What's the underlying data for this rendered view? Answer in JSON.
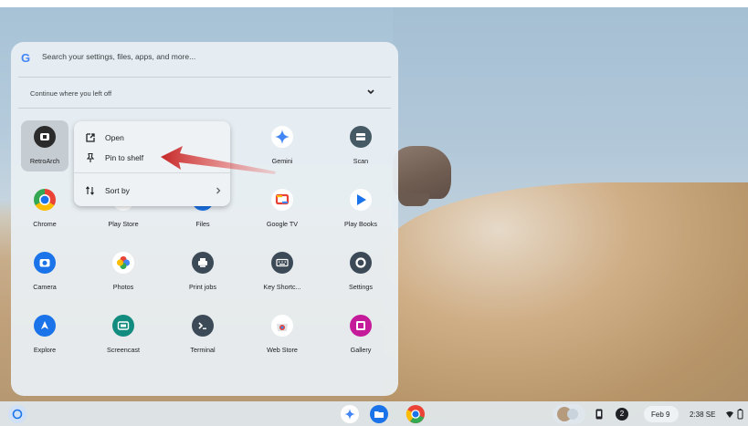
{
  "search": {
    "placeholder": "Search your settings, files, apps, and more..."
  },
  "continue": {
    "label": "Continue where you left off"
  },
  "apps": [
    {
      "label": "RetroArch",
      "icon": "retroarch-icon",
      "color": "#2b2b2b"
    },
    {
      "label": "",
      "icon": "",
      "color": ""
    },
    {
      "label": "",
      "icon": "",
      "color": ""
    },
    {
      "label": "Gemini",
      "icon": "gemini-icon",
      "color": "#4285f4"
    },
    {
      "label": "Scan",
      "icon": "scan-icon",
      "color": "#455a64"
    },
    {
      "label": "Chrome",
      "icon": "chrome-icon",
      "color": "#ea4335"
    },
    {
      "label": "Play Store",
      "icon": "play-store-icon",
      "color": "#34a853"
    },
    {
      "label": "Files",
      "icon": "files-icon",
      "color": "#1a73e8"
    },
    {
      "label": "Google TV",
      "icon": "google-tv-icon",
      "color": "#ea4335"
    },
    {
      "label": "Play Books",
      "icon": "play-books-icon",
      "color": "#1a73e8"
    },
    {
      "label": "Camera",
      "icon": "camera-icon",
      "color": "#1a73e8"
    },
    {
      "label": "Photos",
      "icon": "photos-icon",
      "color": "#fbbc04"
    },
    {
      "label": "Print jobs",
      "icon": "print-jobs-icon",
      "color": "#3c4a57"
    },
    {
      "label": "Key Shortc...",
      "icon": "keyboard-shortcuts-icon",
      "color": "#3c4a57"
    },
    {
      "label": "Settings",
      "icon": "settings-icon",
      "color": "#3c4a57"
    },
    {
      "label": "Explore",
      "icon": "explore-icon",
      "color": "#1a73e8"
    },
    {
      "label": "Screencast",
      "icon": "screencast-icon",
      "color": "#128c7e"
    },
    {
      "label": "Terminal",
      "icon": "terminal-icon",
      "color": "#3c4a57"
    },
    {
      "label": "Web Store",
      "icon": "web-store-icon",
      "color": "#ea4335"
    },
    {
      "label": "Gallery",
      "icon": "gallery-icon",
      "color": "#c51a9a"
    }
  ],
  "context_menu": {
    "open": "Open",
    "pin": "Pin to shelf",
    "sort": "Sort by"
  },
  "shelf": {
    "date": "Feb 9",
    "time": "2:38 SE",
    "notification_count": "2"
  },
  "colors": {
    "accent": "#1a73e8",
    "arrow": "#e53935"
  }
}
